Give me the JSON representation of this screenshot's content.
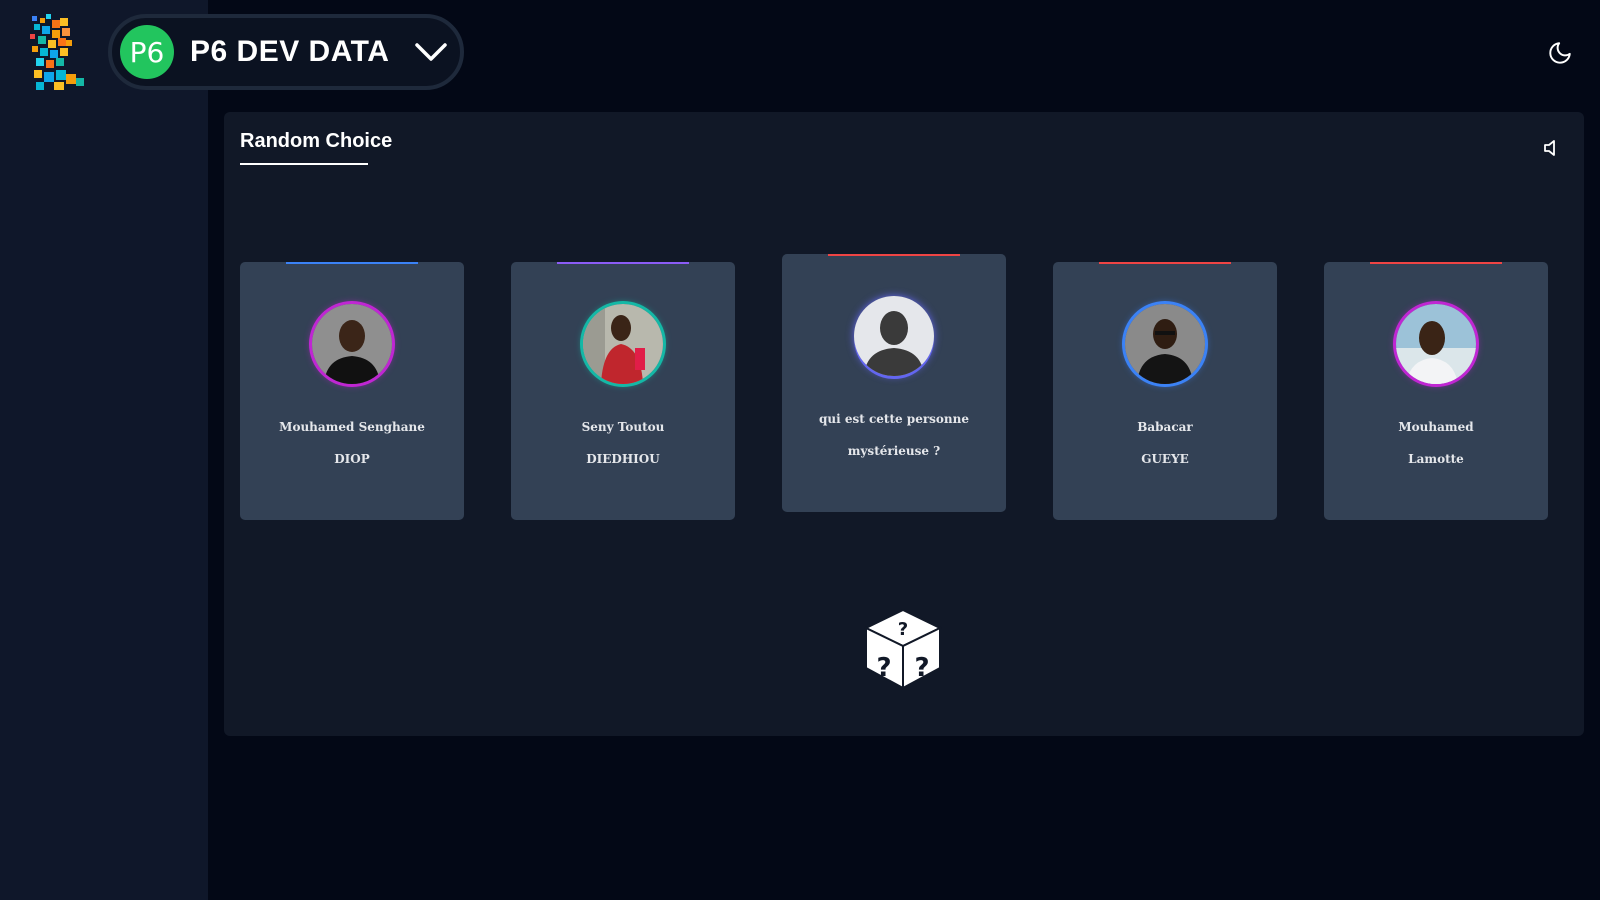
{
  "header": {
    "team_initials": "P6",
    "team_name": "P6 DEV DATA"
  },
  "icons": {
    "logo": "pixel-head-logo-icon",
    "team_dropdown": "chevron-down-icon",
    "theme_toggle": "moon-icon",
    "sound": "speaker-icon",
    "randomize": "dice-question-icon"
  },
  "panel": {
    "title": "Random Choice"
  },
  "cards": [
    {
      "first_name": "Mouhamed Senghane",
      "last_name": "DIOP",
      "accent": "#3b82f6",
      "ring": "#c026d3"
    },
    {
      "first_name": "Seny Toutou",
      "last_name": "DIEDHIOU",
      "accent": "#8b5cf6",
      "ring": "#14b8a6"
    },
    {
      "first_name": "qui est cette personne",
      "last_name": "mystérieuse ?",
      "accent": "#ef4444",
      "ring": "#6366f1"
    },
    {
      "first_name": "Babacar",
      "last_name": "GUEYE",
      "accent": "#ef4444",
      "ring": "#3b82f6"
    },
    {
      "first_name": "Mouhamed",
      "last_name": "Lamotte",
      "accent": "#ef4444",
      "ring": "#c026d3"
    }
  ],
  "colors": {
    "background": "#030816",
    "sidebar": "#0f172a",
    "panel": "#111827",
    "card": "#334155",
    "team_badge": "#22c55e"
  }
}
